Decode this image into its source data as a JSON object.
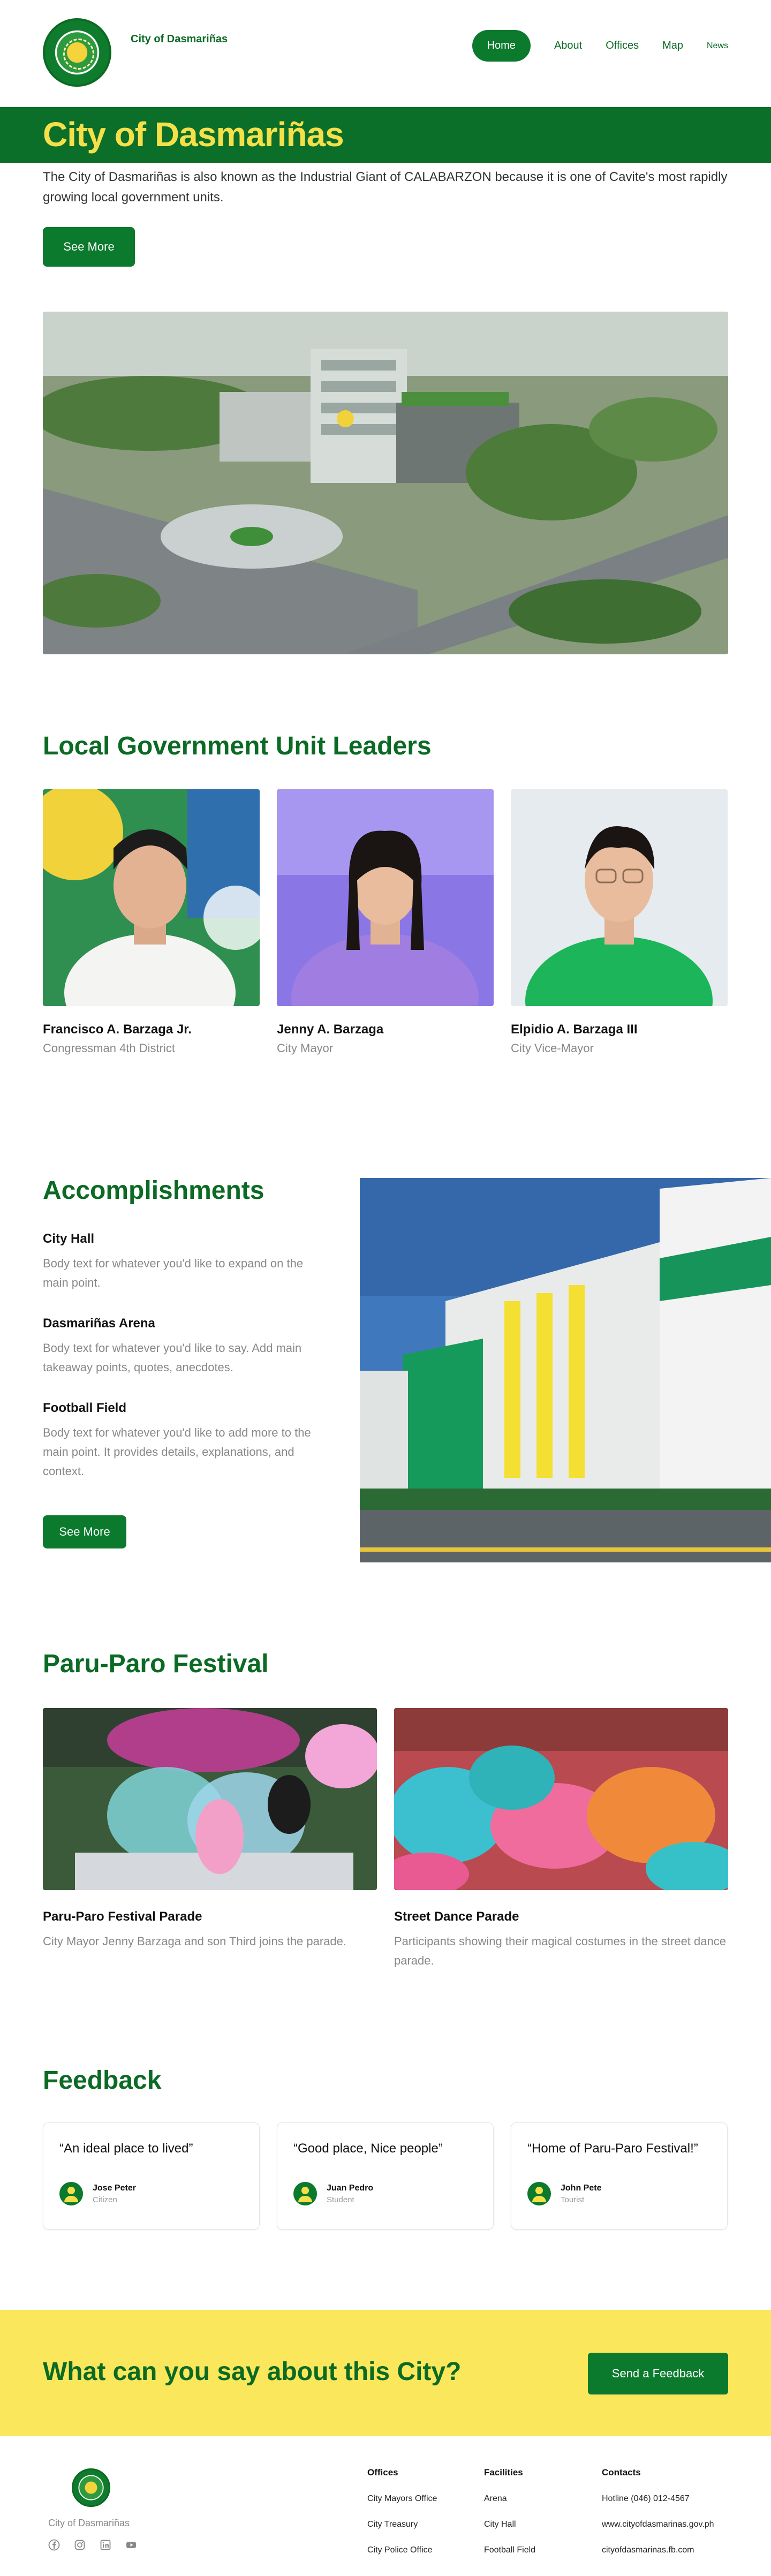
{
  "header": {
    "brand": "City of Dasmariñas",
    "nav": [
      "Home",
      "About",
      "Offices",
      "Map",
      "News"
    ]
  },
  "banner": {
    "title": "City of Dasmariñas",
    "intro": "The City of Dasmariñas is also known as the Industrial Giant of CALABARZON because it is one of Cavite's most rapidly growing local government units.",
    "button": "See More"
  },
  "leaders": {
    "title": "Local Government Unit Leaders",
    "items": [
      {
        "name": "Francisco A. Barzaga Jr.",
        "role": "Congressman 4th District"
      },
      {
        "name": "Jenny A. Barzaga",
        "role": "City Mayor"
      },
      {
        "name": "Elpidio A. Barzaga III",
        "role": "City Vice-Mayor"
      }
    ]
  },
  "accomplishments": {
    "title": "Accomplishments",
    "items": [
      {
        "title": "City Hall",
        "body": "Body text for whatever you'd like to expand on the main point."
      },
      {
        "title": "Dasmariñas Arena",
        "body": "Body text for whatever you'd like to say. Add main takeaway points, quotes, anecdotes."
      },
      {
        "title": "Football Field",
        "body": "Body text for whatever you'd like to add more to the main point. It provides details, explanations, and context."
      }
    ],
    "button": "See More"
  },
  "festival": {
    "title": "Paru-Paro Festival",
    "items": [
      {
        "title": "Paru-Paro Festival Parade",
        "desc": "City Mayor Jenny Barzaga and son Third joins the parade."
      },
      {
        "title": "Street Dance Parade",
        "desc": "Participants showing their magical costumes in the street dance parade."
      }
    ]
  },
  "feedback": {
    "title": "Feedback",
    "items": [
      {
        "quote": "“An ideal place to lived”",
        "name": "Jose Peter",
        "type": "Citizen"
      },
      {
        "quote": "“Good place, Nice people”",
        "name": "Juan Pedro",
        "type": "Student"
      },
      {
        "quote": "“Home of Paru-Paro Festival!”",
        "name": "John Pete",
        "type": "Tourist"
      }
    ]
  },
  "cta": {
    "title": "What can you say about this City?",
    "button": "Send a Feedback"
  },
  "footer": {
    "name": "City of Dasmariñas",
    "social_icons": [
      "facebook-icon",
      "instagram-icon",
      "linkedin-icon",
      "youtube-icon"
    ],
    "columns": [
      {
        "title": "Offices",
        "items": [
          "City Mayors Office",
          "City Treasury",
          "City Police Office"
        ]
      },
      {
        "title": "Facilities",
        "items": [
          "Arena",
          "City Hall",
          "Football Field"
        ]
      },
      {
        "title": "Contacts",
        "items": [
          "Hotline (046) 012-4567",
          "www.cityofdasmarinas.gov.ph",
          "cityofdasmarinas.fb.com"
        ]
      }
    ]
  },
  "colors": {
    "primary_green": "#0b7a2d",
    "banner_green": "#0b6f2a",
    "accent_yellow": "#f6e04a",
    "cta_yellow": "#fbe75b"
  }
}
